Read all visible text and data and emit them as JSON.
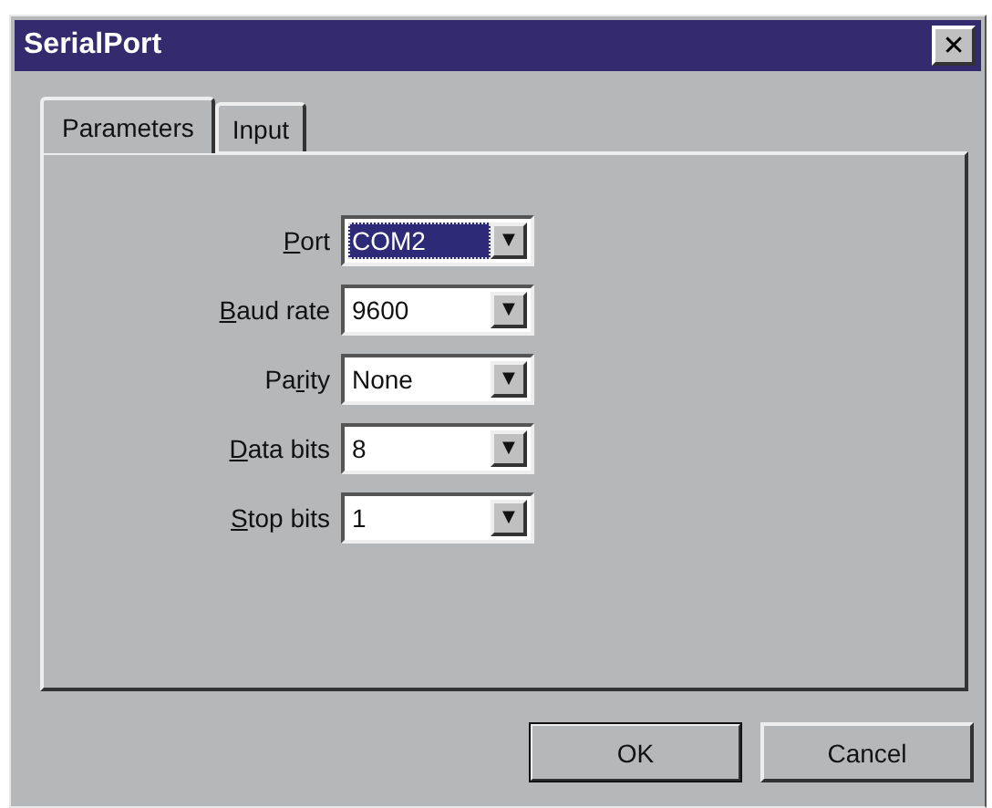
{
  "window": {
    "title": "SerialPort",
    "close": "✕"
  },
  "tabs": [
    {
      "label": "Parameters",
      "selected": true
    },
    {
      "label": "Input",
      "selected": false
    }
  ],
  "fields": [
    {
      "label_key": "P",
      "label_rest": "ort",
      "value": "COM2",
      "focused": true,
      "arrow": "▼"
    },
    {
      "label_key": "B",
      "label_rest": "aud rate",
      "value": "9600",
      "focused": false,
      "arrow": "▼"
    },
    {
      "label_start": "Pa",
      "label_key": "r",
      "label_rest": "ity",
      "value": "None",
      "focused": false,
      "arrow": "▼"
    },
    {
      "label_key": "D",
      "label_rest": "ata bits",
      "value": "8",
      "focused": false,
      "arrow": "▼"
    },
    {
      "label_key": "S",
      "label_rest": "top bits",
      "value": "1",
      "focused": false,
      "arrow": "▼"
    }
  ],
  "buttons": [
    {
      "label": "OK",
      "default": true
    },
    {
      "label": "Cancel",
      "default": false
    }
  ]
}
